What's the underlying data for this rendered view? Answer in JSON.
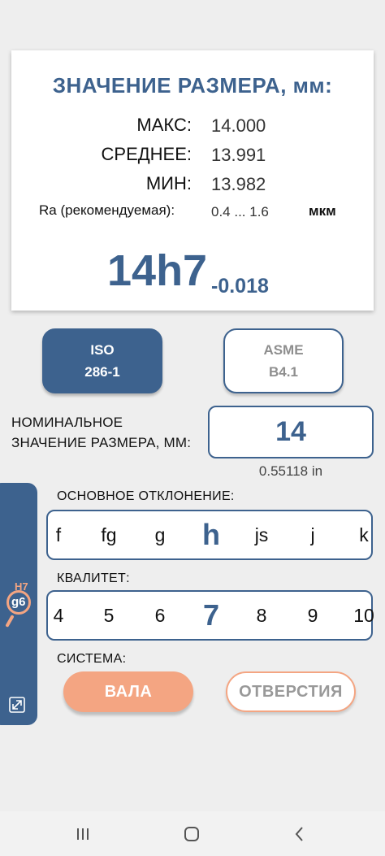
{
  "result": {
    "title": "ЗНАЧЕНИЕ РАЗМЕРА, мм:",
    "rows": [
      {
        "label": "МАКС:",
        "value": "14.000"
      },
      {
        "label": "СРЕДНЕЕ:",
        "value": "13.991"
      },
      {
        "label": "МИН:",
        "value": "13.982"
      }
    ],
    "ra_label": "Ra (рекомендуемая):",
    "ra_value": "0.4 ... 1.6",
    "ra_unit": "мкм",
    "designation": "14h7",
    "deviation": "-0.018"
  },
  "standards": {
    "iso": {
      "line1": "ISO",
      "line2": "286-1",
      "selected": true
    },
    "asme": {
      "line1": "ASME",
      "line2": "B4.1",
      "selected": false
    }
  },
  "nominal": {
    "label_line1": "НОМИНАЛЬНОЕ",
    "label_line2": "ЗНАЧЕНИЕ РАЗМЕРА, ММ:",
    "value": "14",
    "inch": "0.55118 in"
  },
  "side_panel": {
    "hole_fit": "H7",
    "shaft_fit": "g6",
    "icons": [
      "fit-magnifier-icon",
      "expand-icon"
    ]
  },
  "deviation_selector": {
    "label": "ОСНОВНОЕ ОТКЛОНЕНИЕ:",
    "options": [
      "f",
      "fg",
      "g",
      "h",
      "js",
      "j",
      "k"
    ],
    "selected": "h"
  },
  "grade_selector": {
    "label": "КВАЛИТЕТ:",
    "options": [
      "4",
      "5",
      "6",
      "7",
      "8",
      "9",
      "10"
    ],
    "selected": "7"
  },
  "system": {
    "label": "СИСТЕМА:",
    "shaft": "ВАЛА",
    "hole": "ОТВЕРСТИЯ",
    "selected": "shaft"
  },
  "navbar": {
    "icons": [
      "recent-apps-icon",
      "home-icon",
      "back-icon"
    ]
  },
  "colors": {
    "primary": "#3d628e",
    "accent": "#f4a582",
    "background": "#eeeeee"
  }
}
